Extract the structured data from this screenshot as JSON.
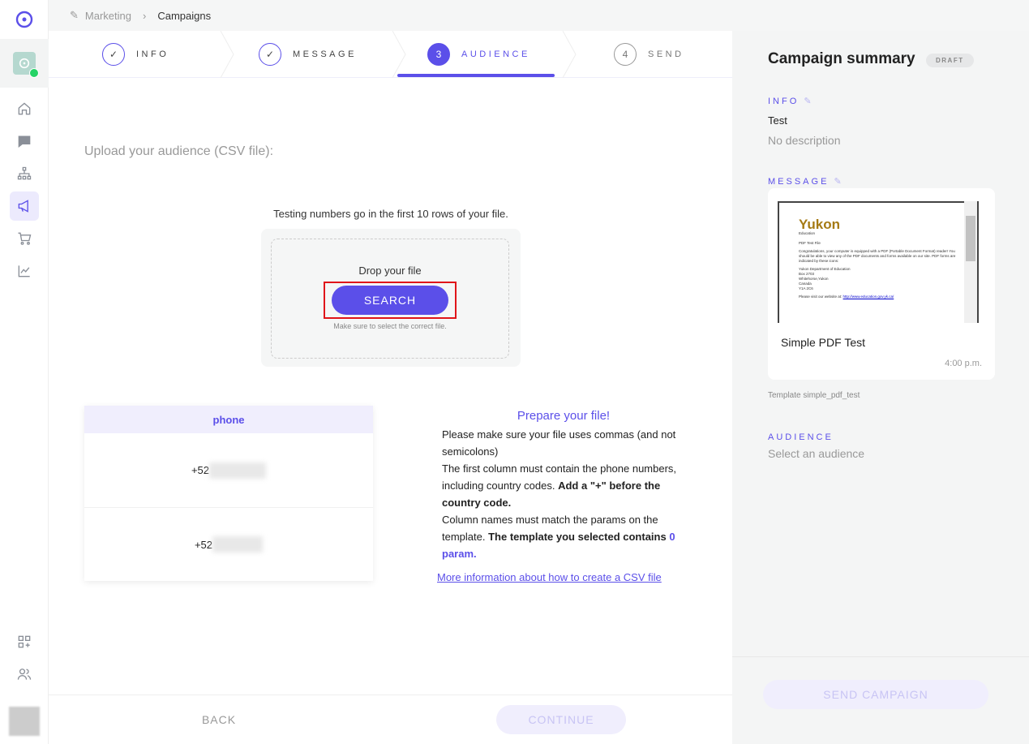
{
  "breadcrumb": {
    "parent": "Marketing",
    "current": "Campaigns"
  },
  "steps": [
    {
      "label": "INFO",
      "state": "done"
    },
    {
      "label": "MESSAGE",
      "state": "done"
    },
    {
      "label": "AUDIENCE",
      "number": "3",
      "state": "active"
    },
    {
      "label": "SEND",
      "number": "4",
      "state": "pending"
    }
  ],
  "upload": {
    "title": "Upload your audience (CSV file):",
    "testing_note": "Testing numbers go in the first 10 rows of your file.",
    "drop_label": "Drop your file",
    "search_button": "SEARCH",
    "hint": "Make sure to select the correct file."
  },
  "preview_table": {
    "header": "phone",
    "rows": [
      "+52",
      "+52"
    ]
  },
  "prepare": {
    "title": "Prepare your file!",
    "p1": "Please make sure your file uses commas (and not semicolons)",
    "p2": "The first column must contain the phone numbers, including country codes. ",
    "p2_bold": "Add a \"+\" before the country code.",
    "p3": "Column names must match the params on the template. ",
    "p3_bold": "The template you selected contains ",
    "p3_count": "0 param.",
    "link": "More information about how to create a CSV file"
  },
  "footer": {
    "back": "BACK",
    "continue": "CONTINUE"
  },
  "summary": {
    "title": "Campaign summary",
    "badge": "DRAFT",
    "info_label": "INFO",
    "info_name": "Test",
    "info_desc": "No description",
    "message_label": "MESSAGE",
    "message_title": "Simple PDF Test",
    "message_time": "4:00 p.m.",
    "template": "Template simple_pdf_test",
    "audience_label": "AUDIENCE",
    "audience_value": "Select an audience",
    "send_button": "SEND CAMPAIGN",
    "pdf": {
      "logo": "Yukon",
      "logo_sub": "Education",
      "heading": "PDF Test File",
      "body": "Congratulations, your computer is equipped with a PDF (Portable Document Format) reader! You should be able to view any of the PDF documents and forms available on our site. PDF forms are indicated by these icons:",
      "address": [
        "Yukon Department of Education",
        "Box 2703",
        "Whitehorse,Yukon",
        "Canada",
        "Y1A 2C6"
      ],
      "visit": "Please visit our website at:",
      "url": "http://www.education.gov.yk.ca/"
    }
  },
  "colors": {
    "accent": "#5b4fe9",
    "highlight": "#e0151a",
    "whatsapp": "#25d366"
  }
}
